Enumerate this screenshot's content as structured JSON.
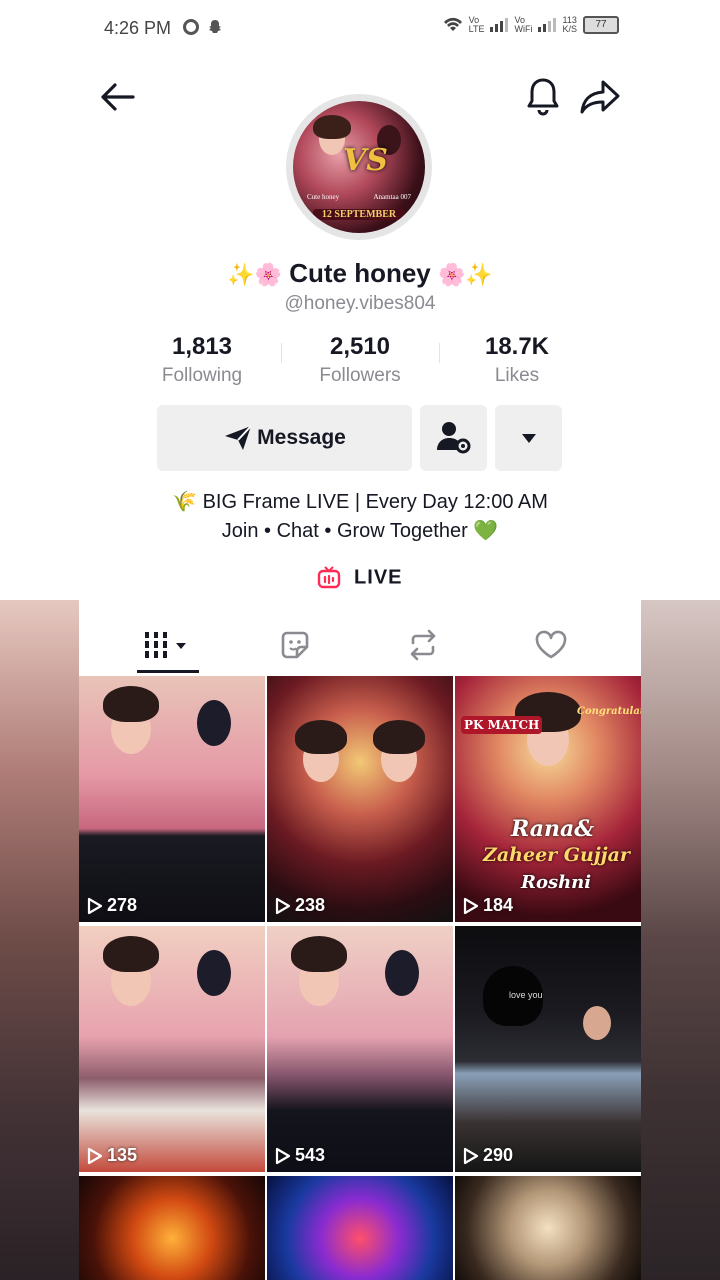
{
  "status_bar": {
    "time": "4:26 PM",
    "net1": "Vo\nLTE",
    "net2": "Vo\nWiFi",
    "speed": "113\nK/S",
    "battery": "77"
  },
  "profile": {
    "name_prefix": "✨🌸",
    "name": "Cute honey",
    "name_suffix": "🌸✨",
    "handle": "@honey.vibes804",
    "avatar": {
      "vs": "VS",
      "left_name": "Cute honey",
      "right_name": "Anamtaa 007",
      "date": "12 SEPTEMBER"
    }
  },
  "stats": [
    {
      "value": "1,813",
      "label": "Following"
    },
    {
      "value": "2,510",
      "label": "Followers"
    },
    {
      "value": "18.7K",
      "label": "Likes"
    }
  ],
  "actions": {
    "message_label": "Message"
  },
  "bio": {
    "line1": "🌾 BIG Frame LIVE | Every Day 12:00 AM",
    "line2": "Join • Chat • Grow Together 💚"
  },
  "live_label": "LIVE",
  "videos": [
    {
      "views": "278"
    },
    {
      "views": "238"
    },
    {
      "views": "184",
      "text1": "Rana&",
      "text2": "Zaheer Gujjar",
      "text3": "Roshni",
      "corner": "PK MATCH",
      "right": "Congratulations"
    },
    {
      "views": "135"
    },
    {
      "views": "543"
    },
    {
      "views": "290",
      "caption": "love you"
    },
    {
      "views": ""
    },
    {
      "views": ""
    },
    {
      "views": ""
    }
  ],
  "colors": {
    "live_icon": "#fe2c55",
    "muted_text": "#8a8b91",
    "button_bg": "#efeff0"
  }
}
